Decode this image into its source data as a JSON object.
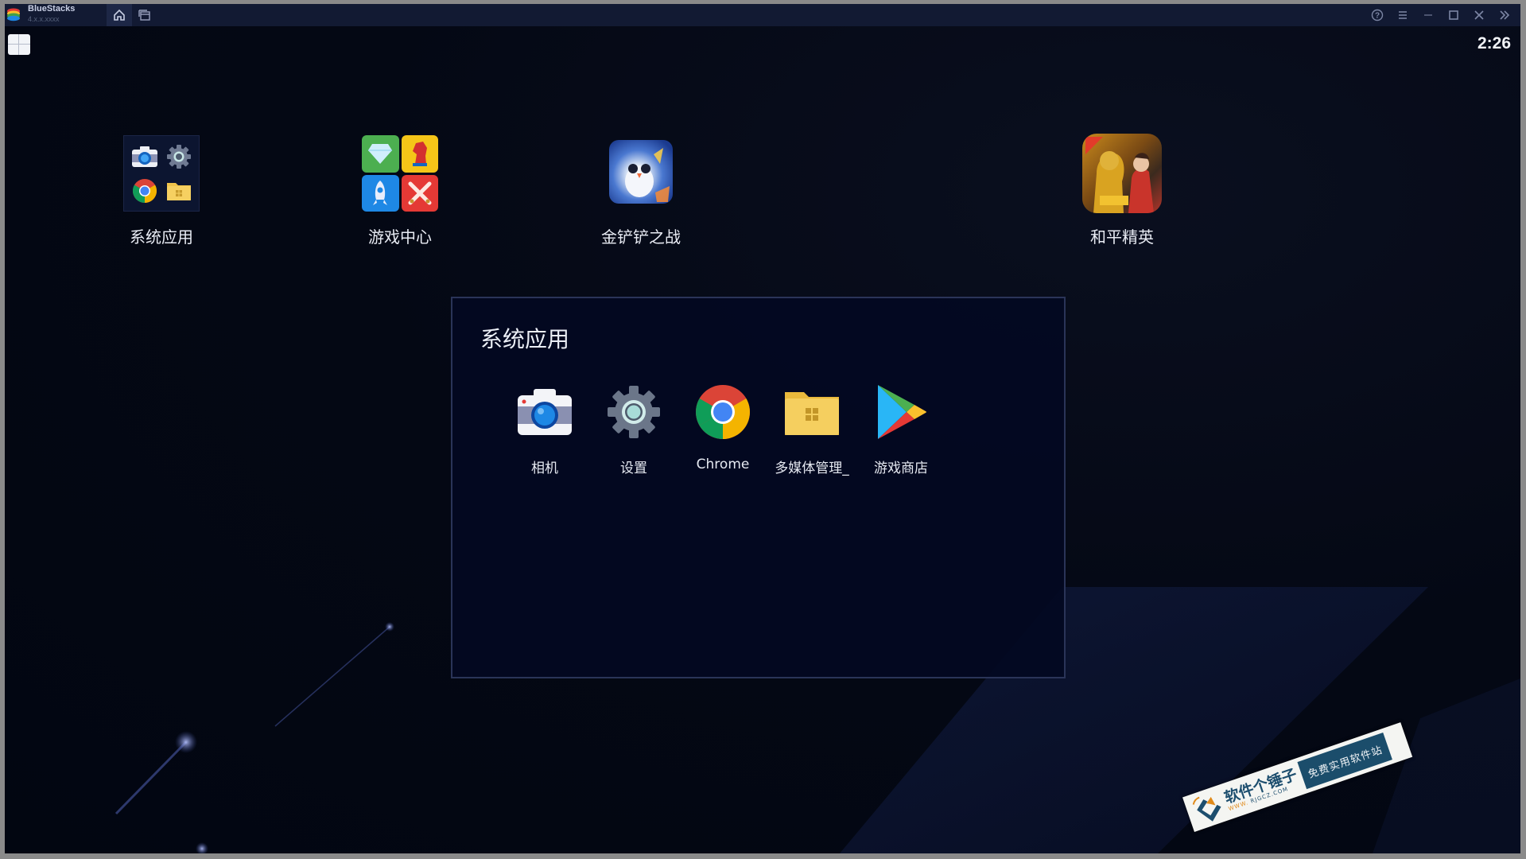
{
  "titlebar": {
    "app_name": "BlueStacks",
    "app_version": "4.x.x.xxxx",
    "tabs": [
      {
        "name": "home-tab",
        "icon": "home-icon"
      },
      {
        "name": "multi-instance-tab",
        "icon": "window-icon"
      }
    ],
    "controls": [
      {
        "name": "help-button",
        "icon": "help-icon"
      },
      {
        "name": "menu-button",
        "icon": "menu-icon"
      },
      {
        "name": "minimize-button",
        "icon": "minimize-icon"
      },
      {
        "name": "maximize-button",
        "icon": "maximize-icon"
      },
      {
        "name": "close-button",
        "icon": "close-icon"
      },
      {
        "name": "sidebar-toggle-button",
        "icon": "double-chevron-right-icon"
      }
    ]
  },
  "statusbar": {
    "time": "2:26"
  },
  "desktop": {
    "apps": [
      {
        "label": "系统应用",
        "type": "folder",
        "icon": "system-apps-folder-icon"
      },
      {
        "label": "游戏中心",
        "type": "app",
        "icon": "game-center-icon"
      },
      {
        "label": "金铲铲之战",
        "type": "app",
        "icon": "golden-spatula-icon"
      },
      {
        "label": "和平精英",
        "type": "app",
        "icon": "peacekeeper-elite-icon"
      }
    ]
  },
  "folder_panel": {
    "title": "系统应用",
    "apps": [
      {
        "label": "相机",
        "icon": "camera-icon"
      },
      {
        "label": "设置",
        "icon": "settings-gear-icon"
      },
      {
        "label": "Chrome",
        "icon": "chrome-icon"
      },
      {
        "label": "多媒体管理_",
        "icon": "media-manager-folder-icon"
      },
      {
        "label": "游戏商店",
        "icon": "play-store-icon"
      }
    ]
  },
  "watermark": {
    "name": "软件个锤子",
    "url_prefix": "WWW.",
    "url": "RJGCZ.COM",
    "slogan": "免费实用软件站"
  },
  "colors": {
    "titlebar_bg": "#121a33",
    "screen_bg": "#030712",
    "panel_border": "#2a3458",
    "watermark_blue": "#1b4d6b",
    "watermark_orange": "#e08a1a"
  }
}
